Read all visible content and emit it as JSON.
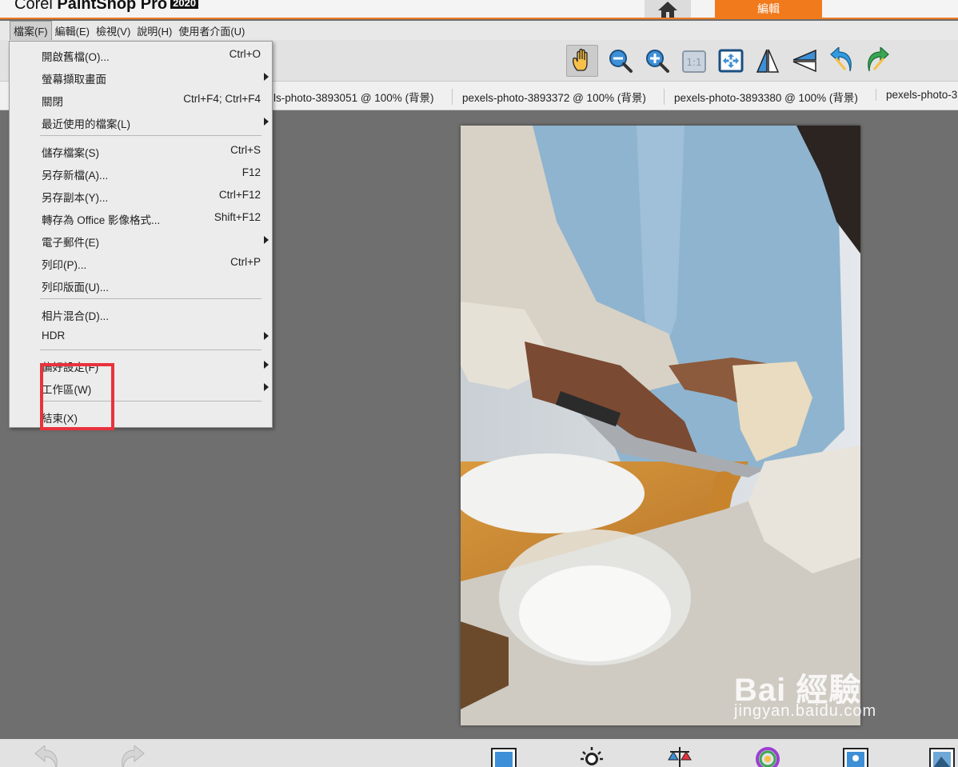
{
  "app": {
    "title_prefix": "Corel ",
    "title_brand": "PaintShop Pro",
    "title_year": "2020",
    "edit_tab": "編輯"
  },
  "colors": {
    "accent": "#f07a1c",
    "highlight": "#e8323c"
  },
  "menubar": [
    {
      "label": "檔案(F)",
      "active": true
    },
    {
      "label": "編輯(E)"
    },
    {
      "label": "檢視(V)"
    },
    {
      "label": "說明(H)"
    },
    {
      "label": "使用者介面(U)"
    }
  ],
  "toolbar": {
    "icons": [
      "pan-hand-icon",
      "zoom-out-icon",
      "zoom-in-icon",
      "actual-size-icon",
      "fit-window-icon",
      "flip-icon",
      "mirror-icon",
      "rotate-left-icon",
      "rotate-right-icon"
    ]
  },
  "doc_tabs": [
    "ls-photo-3893051 @ 100% (背景)",
    "pexels-photo-3893372 @ 100% (背景)",
    "pexels-photo-3893380 @ 100% (背景)",
    "pexels-photo-3"
  ],
  "file_menu": {
    "items": [
      {
        "label": "開啟舊檔(O)...",
        "shortcut": "Ctrl+O"
      },
      {
        "label": "螢幕擷取畫面",
        "submenu": true
      },
      {
        "label": "關閉",
        "shortcut": "Ctrl+F4; Ctrl+F4"
      },
      {
        "label": "最近使用的檔案(L)",
        "submenu": true
      },
      {
        "label": "儲存檔案(S)",
        "shortcut": "Ctrl+S"
      },
      {
        "label": "另存新檔(A)...",
        "shortcut": "F12"
      },
      {
        "label": "另存副本(Y)...",
        "shortcut": "Ctrl+F12"
      },
      {
        "label": "轉存為 Office 影像格式...",
        "shortcut": "Shift+F12"
      },
      {
        "label": "電子郵件(E)",
        "submenu": true
      },
      {
        "label": "列印(P)...",
        "shortcut": "Ctrl+P"
      },
      {
        "label": "列印版面(U)..."
      },
      {
        "label": "相片混合(D)..."
      },
      {
        "label": "HDR",
        "submenu": true
      },
      {
        "label": "偏好設定(F)",
        "submenu": true
      },
      {
        "label": "工作區(W)",
        "submenu": true
      },
      {
        "label": "結束(X)"
      }
    ]
  },
  "watermark": {
    "text": "Bai 經驗",
    "url": "jingyan.baidu.com"
  }
}
